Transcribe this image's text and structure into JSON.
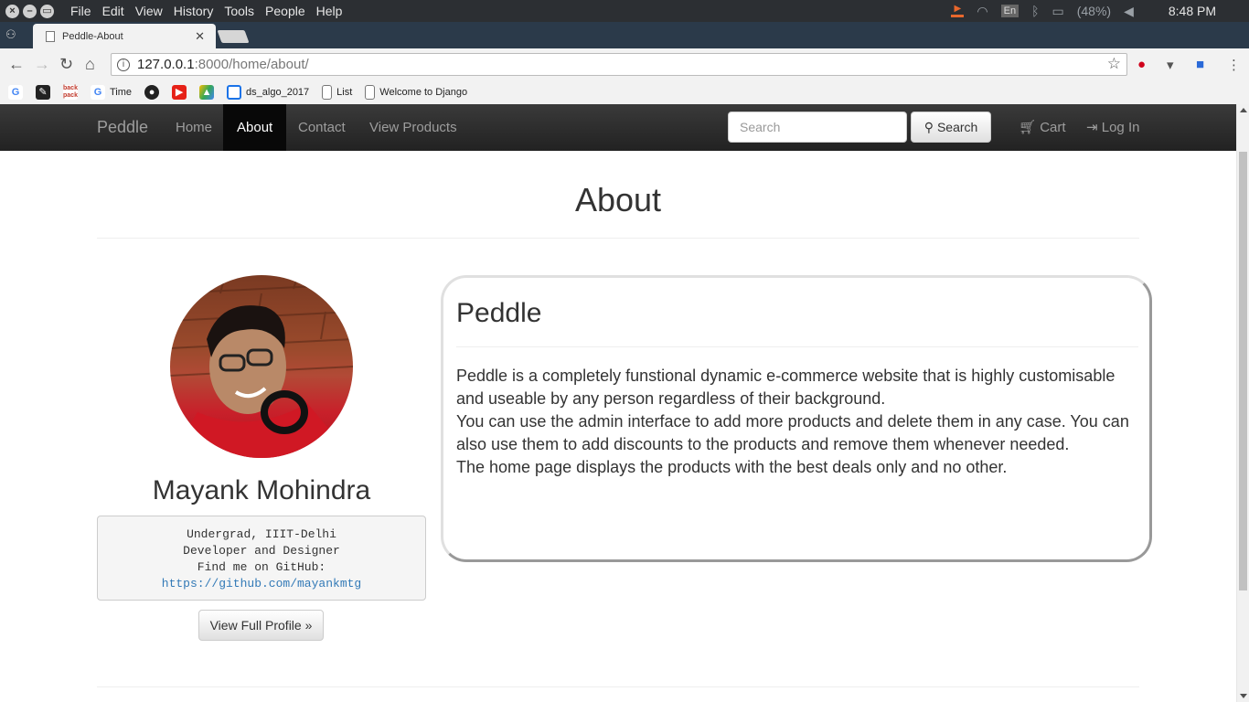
{
  "os": {
    "menu": [
      "File",
      "Edit",
      "View",
      "History",
      "Tools",
      "People",
      "Help"
    ],
    "keyboard_layout": "En",
    "battery": "(48%)",
    "time": "8:48 PM"
  },
  "browser": {
    "tab_title": "Peddle-About",
    "url_host": "127.0.0.1",
    "url_rest": ":8000/home/about/",
    "bookmarks": [
      {
        "icon": "google-icon",
        "label": ""
      },
      {
        "icon": "bookmark-app-icon",
        "label": ""
      },
      {
        "icon": "backpack-icon",
        "label": ""
      },
      {
        "icon": "google-icon",
        "label": "Time"
      },
      {
        "icon": "github-icon",
        "label": ""
      },
      {
        "icon": "youtube-icon",
        "label": ""
      },
      {
        "icon": "drive-icon",
        "label": ""
      },
      {
        "icon": "table-icon",
        "label": "ds_algo_2017"
      },
      {
        "icon": "page-icon",
        "label": "List"
      },
      {
        "icon": "page-icon",
        "label": "Welcome to Django"
      }
    ]
  },
  "navbar": {
    "brand": "Peddle",
    "links": [
      "Home",
      "About",
      "Contact",
      "View Products"
    ],
    "active": "About",
    "search_placeholder": "Search",
    "search_button": "Search",
    "cart": "Cart",
    "login": "Log In"
  },
  "page": {
    "title": "About",
    "profile": {
      "name": "Mayank Mohindra",
      "line1": "Undergrad, IIIT-Delhi",
      "line2": "Developer and Designer",
      "line3": "Find me on GitHub:",
      "github": "https://github.com/mayankmtg",
      "button": "View Full Profile »"
    },
    "card": {
      "title": "Peddle",
      "p1": "Peddle is a completely funstional dynamic e-commerce website that is highly customisable and useable by any person regardless of their background.",
      "p2": "You can use the admin interface to add more products and delete them in any case. You can also use them to add discounts to the products and remove them whenever needed.",
      "p3": "The home page displays the products with the best deals only and no other."
    }
  }
}
